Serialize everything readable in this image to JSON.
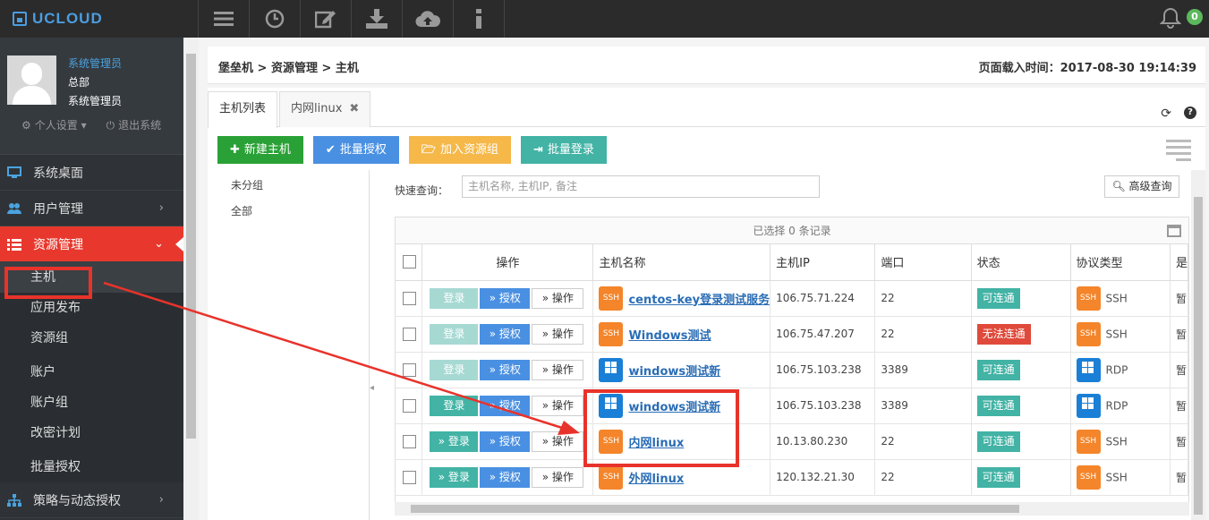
{
  "brand": {
    "name": "UCLOUD",
    "color": "#4a9de0"
  },
  "topbar": {
    "icons": [
      "menu-icon",
      "clock-icon",
      "edit-icon",
      "download-icon",
      "cloud-upload-icon",
      "info-icon"
    ],
    "notification_count": "0"
  },
  "user": {
    "name": "系统管理员",
    "dept": "总部",
    "role": "系统管理员",
    "settings_label": "个人设置",
    "logout_label": "退出系统"
  },
  "sidebar": {
    "desktop": "系统桌面",
    "user_mgmt": "用户管理",
    "resource_mgmt": "资源管理",
    "sub": [
      "主机",
      "应用发布",
      "资源组",
      "账户",
      "账户组",
      "改密计划",
      "批量授权"
    ],
    "policy": "策略与动态授权"
  },
  "breadcrumb": "堡垒机 > 资源管理 > 主机",
  "load_time": "页面载入时间：2017-08-30 19:14:39",
  "tabs": [
    "主机列表",
    "内网linux"
  ],
  "toolbar": {
    "new_host": "新建主机",
    "batch_auth": "批量授权",
    "add_group": "加入资源组",
    "batch_login": "批量登录"
  },
  "tree": [
    "未分组",
    "全部"
  ],
  "search": {
    "label": "快速查询：",
    "placeholder": "主机名称, 主机IP, 备注",
    "advanced": "高级查询"
  },
  "table": {
    "selected_info": "已选择 0 条记录",
    "headers": [
      "操作",
      "主机名称",
      "主机IP",
      "端口",
      "状态",
      "协议类型",
      "是"
    ],
    "buttons": {
      "login": "登录",
      "auth": "授权",
      "op": "操作"
    },
    "rows": [
      {
        "name": "centos-key登录测试服务",
        "ip": "106.75.71.224",
        "port": "22",
        "status": "可连通",
        "status_ok": true,
        "proto": "SSH",
        "icon": "SSH",
        "extra": "暂",
        "login_enabled": false
      },
      {
        "name": "Windows测试",
        "ip": "106.75.47.207",
        "port": "22",
        "status": "无法连通",
        "status_ok": false,
        "proto": "SSH",
        "icon": "SSH",
        "extra": "暂",
        "login_enabled": false
      },
      {
        "name": "windows测试新",
        "ip": "106.75.103.238",
        "port": "3389",
        "status": "可连通",
        "status_ok": true,
        "proto": "RDP",
        "icon": "WIN",
        "extra": "暂",
        "login_enabled": false
      },
      {
        "name": "windows测试新",
        "ip": "106.75.103.238",
        "port": "3389",
        "status": "可连通",
        "status_ok": true,
        "proto": "RDP",
        "icon": "WIN",
        "extra": "暂",
        "login_enabled": true
      },
      {
        "name": "内网linux",
        "ip": "10.13.80.230",
        "port": "22",
        "status": "可连通",
        "status_ok": true,
        "proto": "SSH",
        "icon": "SSH",
        "extra": "暂",
        "login_enabled": true
      },
      {
        "name": "外网linux",
        "ip": "120.132.21.30",
        "port": "22",
        "status": "可连通",
        "status_ok": true,
        "proto": "SSH",
        "icon": "SSH",
        "extra": "暂",
        "login_enabled": true
      }
    ]
  },
  "colors": {
    "active_nav": "#e8382d",
    "annotation": "#e8332b",
    "status_ok": "#42b3a5",
    "status_bad": "#e04a3b"
  }
}
